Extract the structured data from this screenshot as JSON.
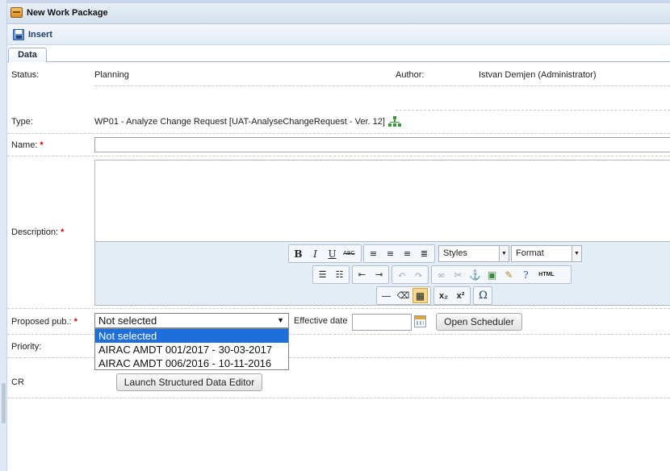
{
  "window": {
    "title": "New Work Package"
  },
  "toolbar": {
    "insert_label": "Insert"
  },
  "tabs": [
    {
      "label": "Data"
    }
  ],
  "form": {
    "status_label": "Status:",
    "status_value": "Planning",
    "author_label": "Author:",
    "author_value": "Istvan Demjen (Administrator)",
    "type_label": "Type:",
    "type_value": "WP01 - Analyze Change Request [UAT-AnalyseChangeRequest - Ver. 12]",
    "name_label": "Name:",
    "name_value": "",
    "description_label": "Description:",
    "required_mark": "*",
    "proposed_label": "Proposed pub.:",
    "proposed_selected": "Not selected",
    "proposed_options": [
      "Not selected",
      "AIRAC AMDT 001/2017 - 30-03-2017",
      "AIRAC AMDT 006/2016 - 10-11-2016"
    ],
    "effective_label": "Effective date",
    "effective_value": "",
    "open_scheduler_label": "Open Scheduler",
    "priority_label": "Priority:",
    "cr_label": "CR",
    "launch_editor_label": "Launch Structured Data Editor"
  },
  "editor": {
    "styles_label": "Styles",
    "format_label": "Format",
    "bold": "B",
    "italic": "I",
    "underline": "U",
    "strike": "ABC",
    "html": "HTML",
    "subscript": "x₂",
    "superscript": "x²",
    "omega": "Ω"
  }
}
